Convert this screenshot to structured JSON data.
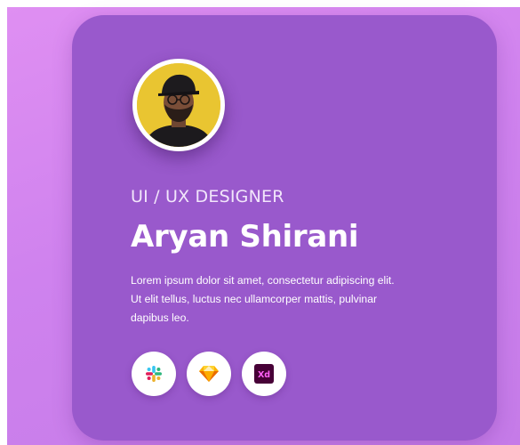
{
  "profile": {
    "role": "UI / UX DESIGNER",
    "name": "Aryan Shirani",
    "bio_lines": [
      "Lorem ipsum dolor sit amet, consectetur adipiscing elit.",
      "Ut elit tellus, luctus nec ullamcorper mattis, pulvinar",
      "dapibus leo."
    ],
    "avatar_icon": "person-photo"
  },
  "tools": [
    {
      "icon": "slack-icon"
    },
    {
      "icon": "sketch-icon"
    },
    {
      "icon": "adobe-xd-icon",
      "label": "Xd"
    }
  ],
  "colors": {
    "background_gradient": [
      "#df8ff2",
      "#c57be8"
    ],
    "card": "#9959cc",
    "text": "#ffffff",
    "xd_badge": "#470137",
    "xd_text": "#ff61f6"
  }
}
